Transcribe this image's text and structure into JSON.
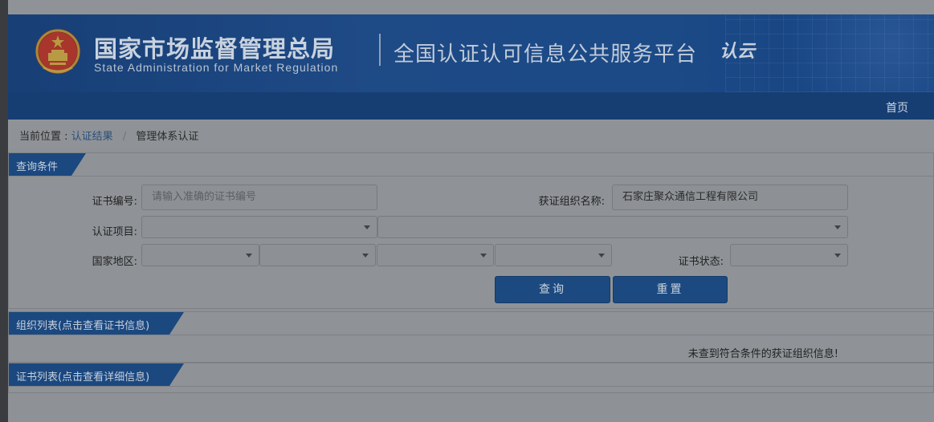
{
  "header": {
    "agency_cn": "国家市场监督管理总局",
    "agency_en": "State Administration  for  Market Regulation",
    "platform": "全国认证认可信息公共服务平台",
    "logo_text": "认云"
  },
  "nav": {
    "home": "首页"
  },
  "breadcrumb": {
    "prefix": "当前位置 :",
    "crumb1": "认证结果",
    "separator": "/",
    "crumb2": "管理体系认证"
  },
  "query": {
    "title": "查询条件",
    "cert_no_label": "证书编号:",
    "cert_no_placeholder": "请输入准确的证书编号",
    "org_label": "获证组织名称:",
    "org_value": "石家庄聚众通信工程有限公司",
    "project_label": "认证项目:",
    "region_label": "国家地区:",
    "status_label": "证书状态:",
    "search_button": "查询",
    "reset_button": "重置"
  },
  "orgs": {
    "title": "组织列表(点击查看证书信息)",
    "empty_message": "未查到符合条件的获证组织信息!"
  },
  "certs": {
    "title": "证书列表(点击查看详细信息)"
  },
  "colors": {
    "header_blue": "#1e4a86",
    "tab_blue": "#1b487f",
    "overlay_gray": "#8f9397"
  }
}
